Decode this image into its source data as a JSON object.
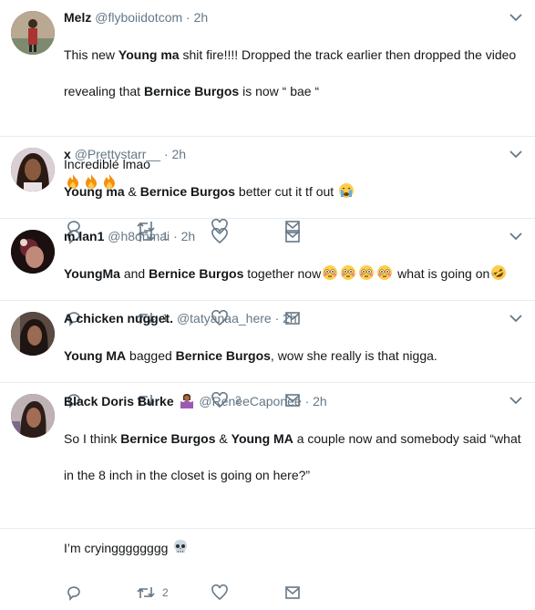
{
  "tweets": [
    {
      "name": "Melz",
      "handle": "@flyboiidotcom",
      "sep": "·",
      "time": "2h",
      "line1_a": "This new ",
      "line1_b": "Young ma",
      "line1_c": " shit fire!!!! Dropped the track earlier then dropped the video",
      "line2_a": "revealing that ",
      "line2_b": "Bernice Burgos",
      "line2_c": " is now “ bae “",
      "line3": "Incredible lmao",
      "reply_count": "",
      "retweet_count": "",
      "like_count": ""
    },
    {
      "name": "x",
      "handle": "@Prettystarr__",
      "sep": "·",
      "time": "2h",
      "t_a": "Young ma",
      "t_b": " & ",
      "t_c": "Bernice Burgos",
      "t_d": " better cut it tf out ",
      "retweet_count": "1"
    },
    {
      "name": "m.lan1",
      "handle": "@h8onmai",
      "sep": "·",
      "time": "2h",
      "t_a": "YoungMa",
      "t_b": " and ",
      "t_c": "Bernice Burgos",
      "t_d": " together now",
      "t_e": " what is going on",
      "retweet_count": "1"
    },
    {
      "name": "A chicken nugget.",
      "handle": "@tatyanaa_here",
      "sep": "·",
      "time": "2h",
      "t_a": "Young MA",
      "t_b": " bagged ",
      "t_c": "Bernice Burgos",
      "t_d": ", wow she really is that nigga.",
      "like_count": "2"
    },
    {
      "name": "Black Doris Burke",
      "handle": "@ReneeCaponee",
      "sep": "·",
      "time": "2h",
      "line1_a": "So I think ",
      "line1_b": "Bernice Burgos",
      "line1_c": " & ",
      "line1_d": "Young MA",
      "line1_e": " a couple now and somebody said “what",
      "line2": "in the 8 inch in the closet is going on here?”",
      "line3": "I’m cryingggggggg",
      "retweet_count": "2"
    }
  ],
  "icons": {
    "reply": "reply-icon",
    "retweet": "retweet-icon",
    "like": "heart-icon",
    "dm": "mail-icon",
    "more": "chevron-down-icon"
  },
  "colors": {
    "text": "#14171a",
    "muted": "#657786",
    "divider": "#e6ecf0"
  }
}
